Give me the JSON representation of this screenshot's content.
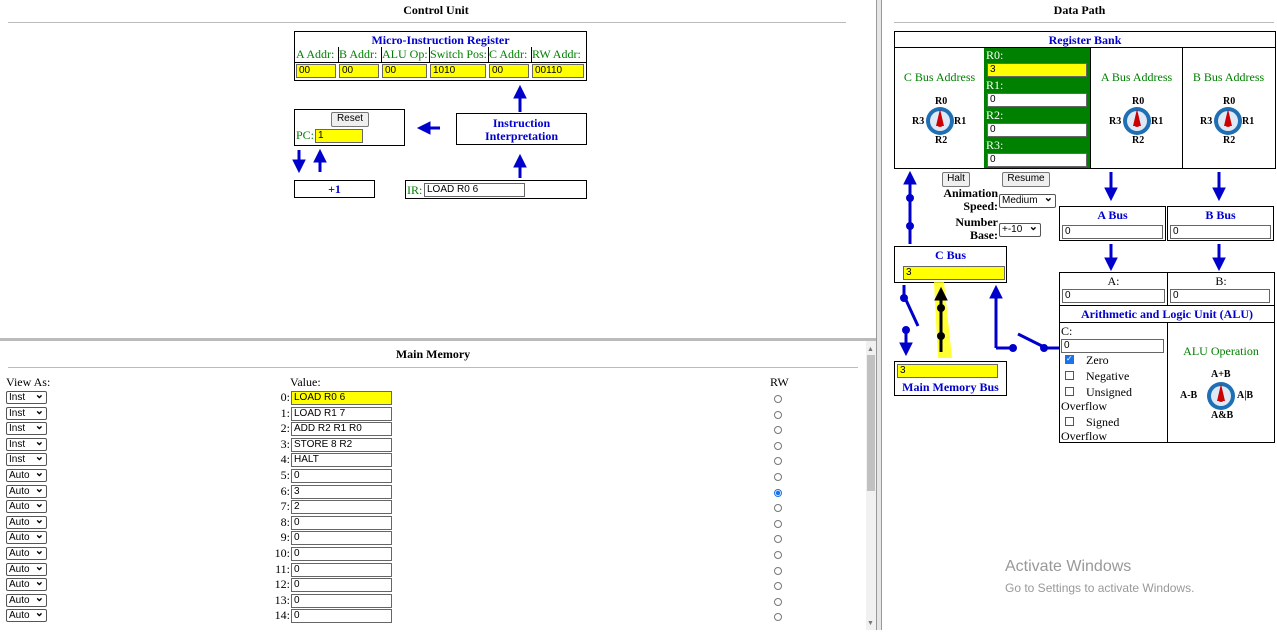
{
  "control_unit": {
    "title": "Control Unit",
    "mir": {
      "title": "Micro-Instruction Register",
      "headers": [
        "A Addr:",
        "B Addr:",
        "ALU Op:",
        "Switch Pos:",
        "C Addr:",
        "RW Addr:"
      ],
      "values": [
        "00",
        "00",
        "00",
        "1010",
        "00",
        "00110"
      ]
    },
    "reset_label": "Reset",
    "pc_label": "PC:",
    "pc_value": "1",
    "interp_line1": "Instruction",
    "interp_line2": "Interpretation",
    "plus_one": "+1",
    "ir_label": "IR:",
    "ir_value": "LOAD R0 6"
  },
  "data_path": {
    "title": "Data Path",
    "register_bank": {
      "title": "Register Bank",
      "c_bus_address": "C Bus Address",
      "a_bus_address": "A Bus Address",
      "b_bus_address": "B Bus Address",
      "registers": [
        {
          "label": "R0:",
          "value": "3"
        },
        {
          "label": "R1:",
          "value": "0"
        },
        {
          "label": "R2:",
          "value": "0"
        },
        {
          "label": "R3:",
          "value": "0"
        }
      ],
      "knob_labels": {
        "top": "R0",
        "left": "R3",
        "right": "R1",
        "bottom": "R2"
      }
    },
    "halt_label": "Halt",
    "resume_label": "Resume",
    "animation_speed_label": "Animation Speed:",
    "animation_speed_value": "Medium",
    "number_base_label": "Number Base:",
    "number_base_value": "+-10",
    "a_bus": {
      "title": "A Bus",
      "value": "0"
    },
    "b_bus": {
      "title": "B Bus",
      "value": "0"
    },
    "c_bus": {
      "title": "C Bus",
      "value": "3"
    },
    "main_memory_bus": {
      "title": "Main Memory Bus",
      "value": "3"
    },
    "alu": {
      "a_label": "A:",
      "a_value": "0",
      "b_label": "B:",
      "b_value": "0",
      "title": "Arithmetic and Logic Unit (ALU)",
      "c_label": "C:",
      "c_value": "0",
      "flags": [
        {
          "label": "Zero",
          "checked": true
        },
        {
          "label": "Negative",
          "checked": false
        },
        {
          "label": "Unsigned Overflow",
          "checked": false
        },
        {
          "label": "Signed Overflow",
          "checked": false
        }
      ],
      "operation_label": "ALU Operation",
      "knob_labels": {
        "top": "A+B",
        "left": "A-B",
        "right": "A|B",
        "bottom": "A&B"
      }
    }
  },
  "main_memory": {
    "title": "Main Memory",
    "view_as_header": "View As:",
    "value_header": "Value:",
    "rw_header": "RW",
    "rows": [
      {
        "addr": "0:",
        "view": "Inst",
        "value": "LOAD R0 6",
        "rw": false,
        "highlight": true
      },
      {
        "addr": "1:",
        "view": "Inst",
        "value": "LOAD R1 7",
        "rw": false
      },
      {
        "addr": "2:",
        "view": "Inst",
        "value": "ADD R2 R1 R0",
        "rw": false
      },
      {
        "addr": "3:",
        "view": "Inst",
        "value": "STORE 8 R2",
        "rw": false
      },
      {
        "addr": "4:",
        "view": "Inst",
        "value": "HALT",
        "rw": false
      },
      {
        "addr": "5:",
        "view": "Auto",
        "value": "0",
        "rw": false
      },
      {
        "addr": "6:",
        "view": "Auto",
        "value": "3",
        "rw": true
      },
      {
        "addr": "7:",
        "view": "Auto",
        "value": "2",
        "rw": false
      },
      {
        "addr": "8:",
        "view": "Auto",
        "value": "0",
        "rw": false
      },
      {
        "addr": "9:",
        "view": "Auto",
        "value": "0",
        "rw": false
      },
      {
        "addr": "10:",
        "view": "Auto",
        "value": "0",
        "rw": false
      },
      {
        "addr": "11:",
        "view": "Auto",
        "value": "0",
        "rw": false
      },
      {
        "addr": "12:",
        "view": "Auto",
        "value": "0",
        "rw": false
      },
      {
        "addr": "13:",
        "view": "Auto",
        "value": "0",
        "rw": false
      },
      {
        "addr": "14:",
        "view": "Auto",
        "value": "0",
        "rw": false
      }
    ]
  },
  "watermark": {
    "line1": "Activate Windows",
    "line2": "Go to Settings to activate Windows."
  },
  "colors": {
    "highlight": "#ffff00",
    "register_green": "#008000",
    "arrow_blue": "#0000cc",
    "knob_blue": "#1f6fb5",
    "knob_pointer": "#cc0000"
  }
}
